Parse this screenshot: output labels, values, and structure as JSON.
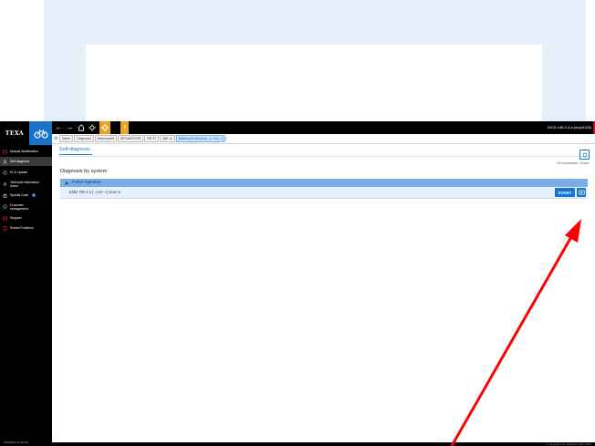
{
  "app": {
    "brand": "TEXA",
    "version": "IDC5 v.56.0.3.a (mup5145)",
    "clock": "6/30/2022 12:36 PM",
    "copyright": "© copyright and database rights 2022"
  },
  "sidebar": {
    "items": [
      {
        "label": "Manual identification",
        "icon": "identification-icon"
      },
      {
        "label": "Self-diagnosis",
        "icon": "self-diagnosis-icon"
      },
      {
        "label": "ECU Update",
        "icon": "ecu-update-icon"
      },
      {
        "label": "Technical information\nd'auto",
        "icon": "technical-info-icon"
      },
      {
        "label": "Special Code",
        "icon": "special-code-icon",
        "badge": "3"
      },
      {
        "label": "Customer\nmanagement",
        "icon": "customer-icon"
      },
      {
        "label": "iSupport",
        "icon": "isupport-icon"
      },
      {
        "label": "Solved Problems",
        "icon": "solved-problems-icon"
      }
    ]
  },
  "breadcrumb": [
    "Menu",
    "Diagnosis",
    "Motorcycles",
    "BETAMOTOR",
    "RR 4T",
    "480 cc",
    "Motorcycle (Enduro) - [-->23-->]"
  ],
  "main": {
    "tab": "Self-diagnosis",
    "vci_label": "VCI connection:",
    "vci_value": "Small1",
    "section_title": "Diagnosis by system",
    "group": "Petrol injection",
    "row_label": "Elder   RR 4.0   [-->23-->]   Euro 5",
    "start": "START"
  },
  "colors": {
    "accent": "#1a73c9",
    "orange": "#f0a020",
    "header_row": "#79ade3",
    "arrow": "#ff0000"
  }
}
